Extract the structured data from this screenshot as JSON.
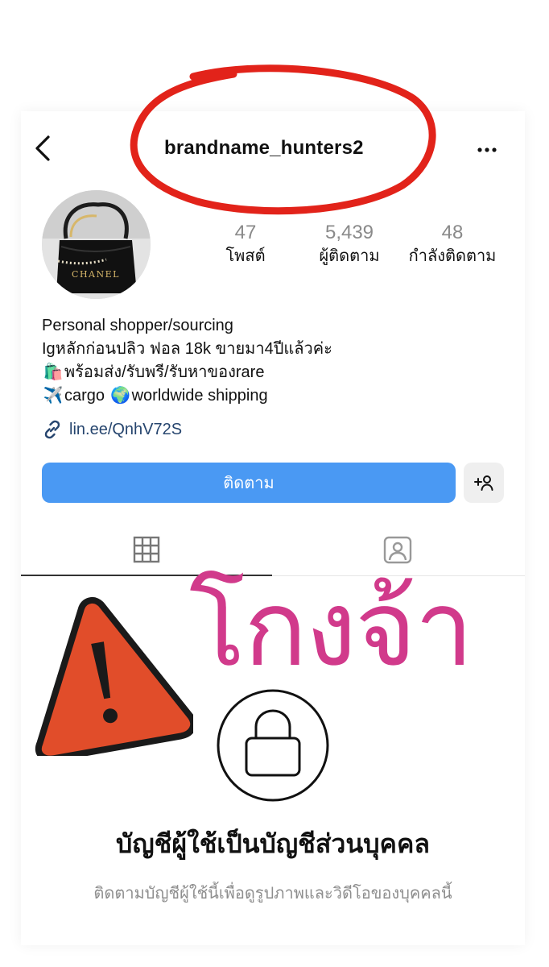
{
  "header": {
    "username": "brandname_hunters2",
    "more_label": "•••",
    "back_label": "back"
  },
  "avatar": {
    "brand_text": "CHANEL"
  },
  "stats": [
    {
      "value": "47",
      "label": "โพสต์"
    },
    {
      "value": "5,439",
      "label": "ผู้ติดตาม"
    },
    {
      "value": "48",
      "label": "กำลังติดตาม"
    }
  ],
  "bio": {
    "line1": "Personal shopper/sourcing",
    "line2": "Igหลักก่อนปลิว ฟอล 18k ขายมา4ปีแล้วค่ะ",
    "line3_emoji": "🛍️",
    "line3": "พร้อมส่ง/รับพรี/รับหาของrare",
    "line4_emoji": "✈️",
    "line4a": "cargo",
    "line4_emoji2": "🌍",
    "line4b": "worldwide shipping"
  },
  "link": {
    "text": "lin.ee/QnhV72S",
    "icon": "link-icon"
  },
  "actions": {
    "follow_label": "ติดตาม",
    "add_user_icon": "add-user-icon"
  },
  "tabs": [
    {
      "name": "grid",
      "icon": "grid-icon",
      "active": true
    },
    {
      "name": "tagged",
      "icon": "tagged-icon",
      "active": false
    }
  ],
  "overlay": {
    "scam_text": "โกงจ้า",
    "warning_icon": "warning-icon"
  },
  "private": {
    "title": "บัญชีผู้ใช้เป็นบัญชีส่วนบุคคล",
    "subtitle": "ติดตามบัญชีผู้ใช้นี้เพื่อดูรูปภาพและวิดีโอของบุคคลนี้"
  },
  "colors": {
    "follow_button": "#4a99f3",
    "scam_text": "#d13a8b",
    "warning_fill": "#e14d2a",
    "annotation_circle": "#e2231a",
    "link": "#26456e"
  }
}
